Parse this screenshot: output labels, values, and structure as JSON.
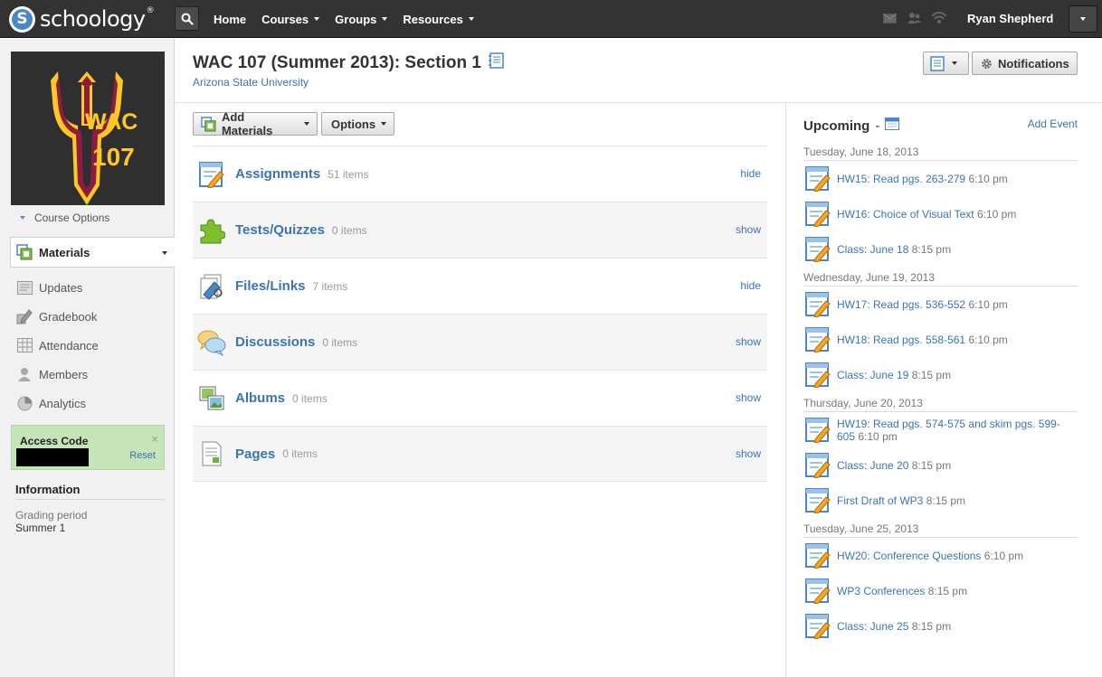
{
  "brand": {
    "name": "schoology",
    "logo_letter": "S",
    "trademark": "®"
  },
  "top_nav": [
    {
      "label": "Home",
      "dropdown": false
    },
    {
      "label": "Courses",
      "dropdown": true
    },
    {
      "label": "Groups",
      "dropdown": true
    },
    {
      "label": "Resources",
      "dropdown": true
    }
  ],
  "user": {
    "name": "Ryan Shepherd"
  },
  "course": {
    "title": "WAC 107 (Summer 2013): Section 1",
    "school": "Arizona State University",
    "image_text_line1": "WAC",
    "image_text_line2": "107"
  },
  "sidebar": {
    "course_options": "Course Options",
    "active": "Materials",
    "items": [
      {
        "label": "Updates",
        "icon": "updates-icon"
      },
      {
        "label": "Gradebook",
        "icon": "gradebook-icon"
      },
      {
        "label": "Attendance",
        "icon": "attendance-icon"
      },
      {
        "label": "Members",
        "icon": "members-icon"
      },
      {
        "label": "Analytics",
        "icon": "analytics-icon"
      }
    ],
    "access_code": {
      "title": "Access Code",
      "reset": "Reset",
      "close": "×"
    },
    "information": {
      "title": "Information",
      "grading_label": "Grading period",
      "grading_value": "Summer 1"
    }
  },
  "toolbar": {
    "add_materials": "Add Materials",
    "options": "Options",
    "notifications": "Notifications"
  },
  "materials": [
    {
      "name": "Assignments",
      "count": "51 items",
      "toggle": "hide",
      "icon": "assignment-icon"
    },
    {
      "name": "Tests/Quizzes",
      "count": "0 items",
      "toggle": "show",
      "icon": "puzzle-icon"
    },
    {
      "name": "Files/Links",
      "count": "7 items",
      "toggle": "hide",
      "icon": "files-icon"
    },
    {
      "name": "Discussions",
      "count": "0 items",
      "toggle": "show",
      "icon": "discussion-icon"
    },
    {
      "name": "Albums",
      "count": "0 items",
      "toggle": "show",
      "icon": "album-icon"
    },
    {
      "name": "Pages",
      "count": "0 items",
      "toggle": "show",
      "icon": "page-icon"
    }
  ],
  "upcoming": {
    "title": "Upcoming",
    "separator": "-",
    "add_event": "Add Event",
    "days": [
      {
        "date": "Tuesday, June 18, 2013",
        "events": [
          {
            "title": "HW15: Read pgs. 263-279",
            "time": "6:10 pm"
          },
          {
            "title": "HW16: Choice of Visual Text",
            "time": "6:10 pm"
          },
          {
            "title": "Class: June 18",
            "time": "8:15 pm"
          }
        ]
      },
      {
        "date": "Wednesday, June 19, 2013",
        "events": [
          {
            "title": "HW17: Read pgs. 536-552",
            "time": "6:10 pm"
          },
          {
            "title": "HW18: Read pgs. 558-561",
            "time": "6:10 pm"
          },
          {
            "title": "Class: June 19",
            "time": "8:15 pm"
          }
        ]
      },
      {
        "date": "Thursday, June 20, 2013",
        "events": [
          {
            "title": "HW19: Read pgs. 574-575 and skim pgs. 599-605",
            "time": "6:10 pm"
          },
          {
            "title": "Class: June 20",
            "time": "8:15 pm"
          },
          {
            "title": "First Draft of WP3",
            "time": "8:15 pm"
          }
        ]
      },
      {
        "date": "Tuesday, June 25, 2013",
        "events": [
          {
            "title": "HW20: Conference Questions",
            "time": "6:10 pm"
          },
          {
            "title": "WP3 Conferences",
            "time": "8:15 pm"
          },
          {
            "title": "Class: June 25",
            "time": "8:15 pm"
          }
        ]
      }
    ]
  },
  "colors": {
    "topbar": "#333333",
    "link": "#3a74b5",
    "access_bg": "#c5e4b8",
    "asu_maroon": "#8c1d40",
    "asu_gold": "#ffc627"
  }
}
